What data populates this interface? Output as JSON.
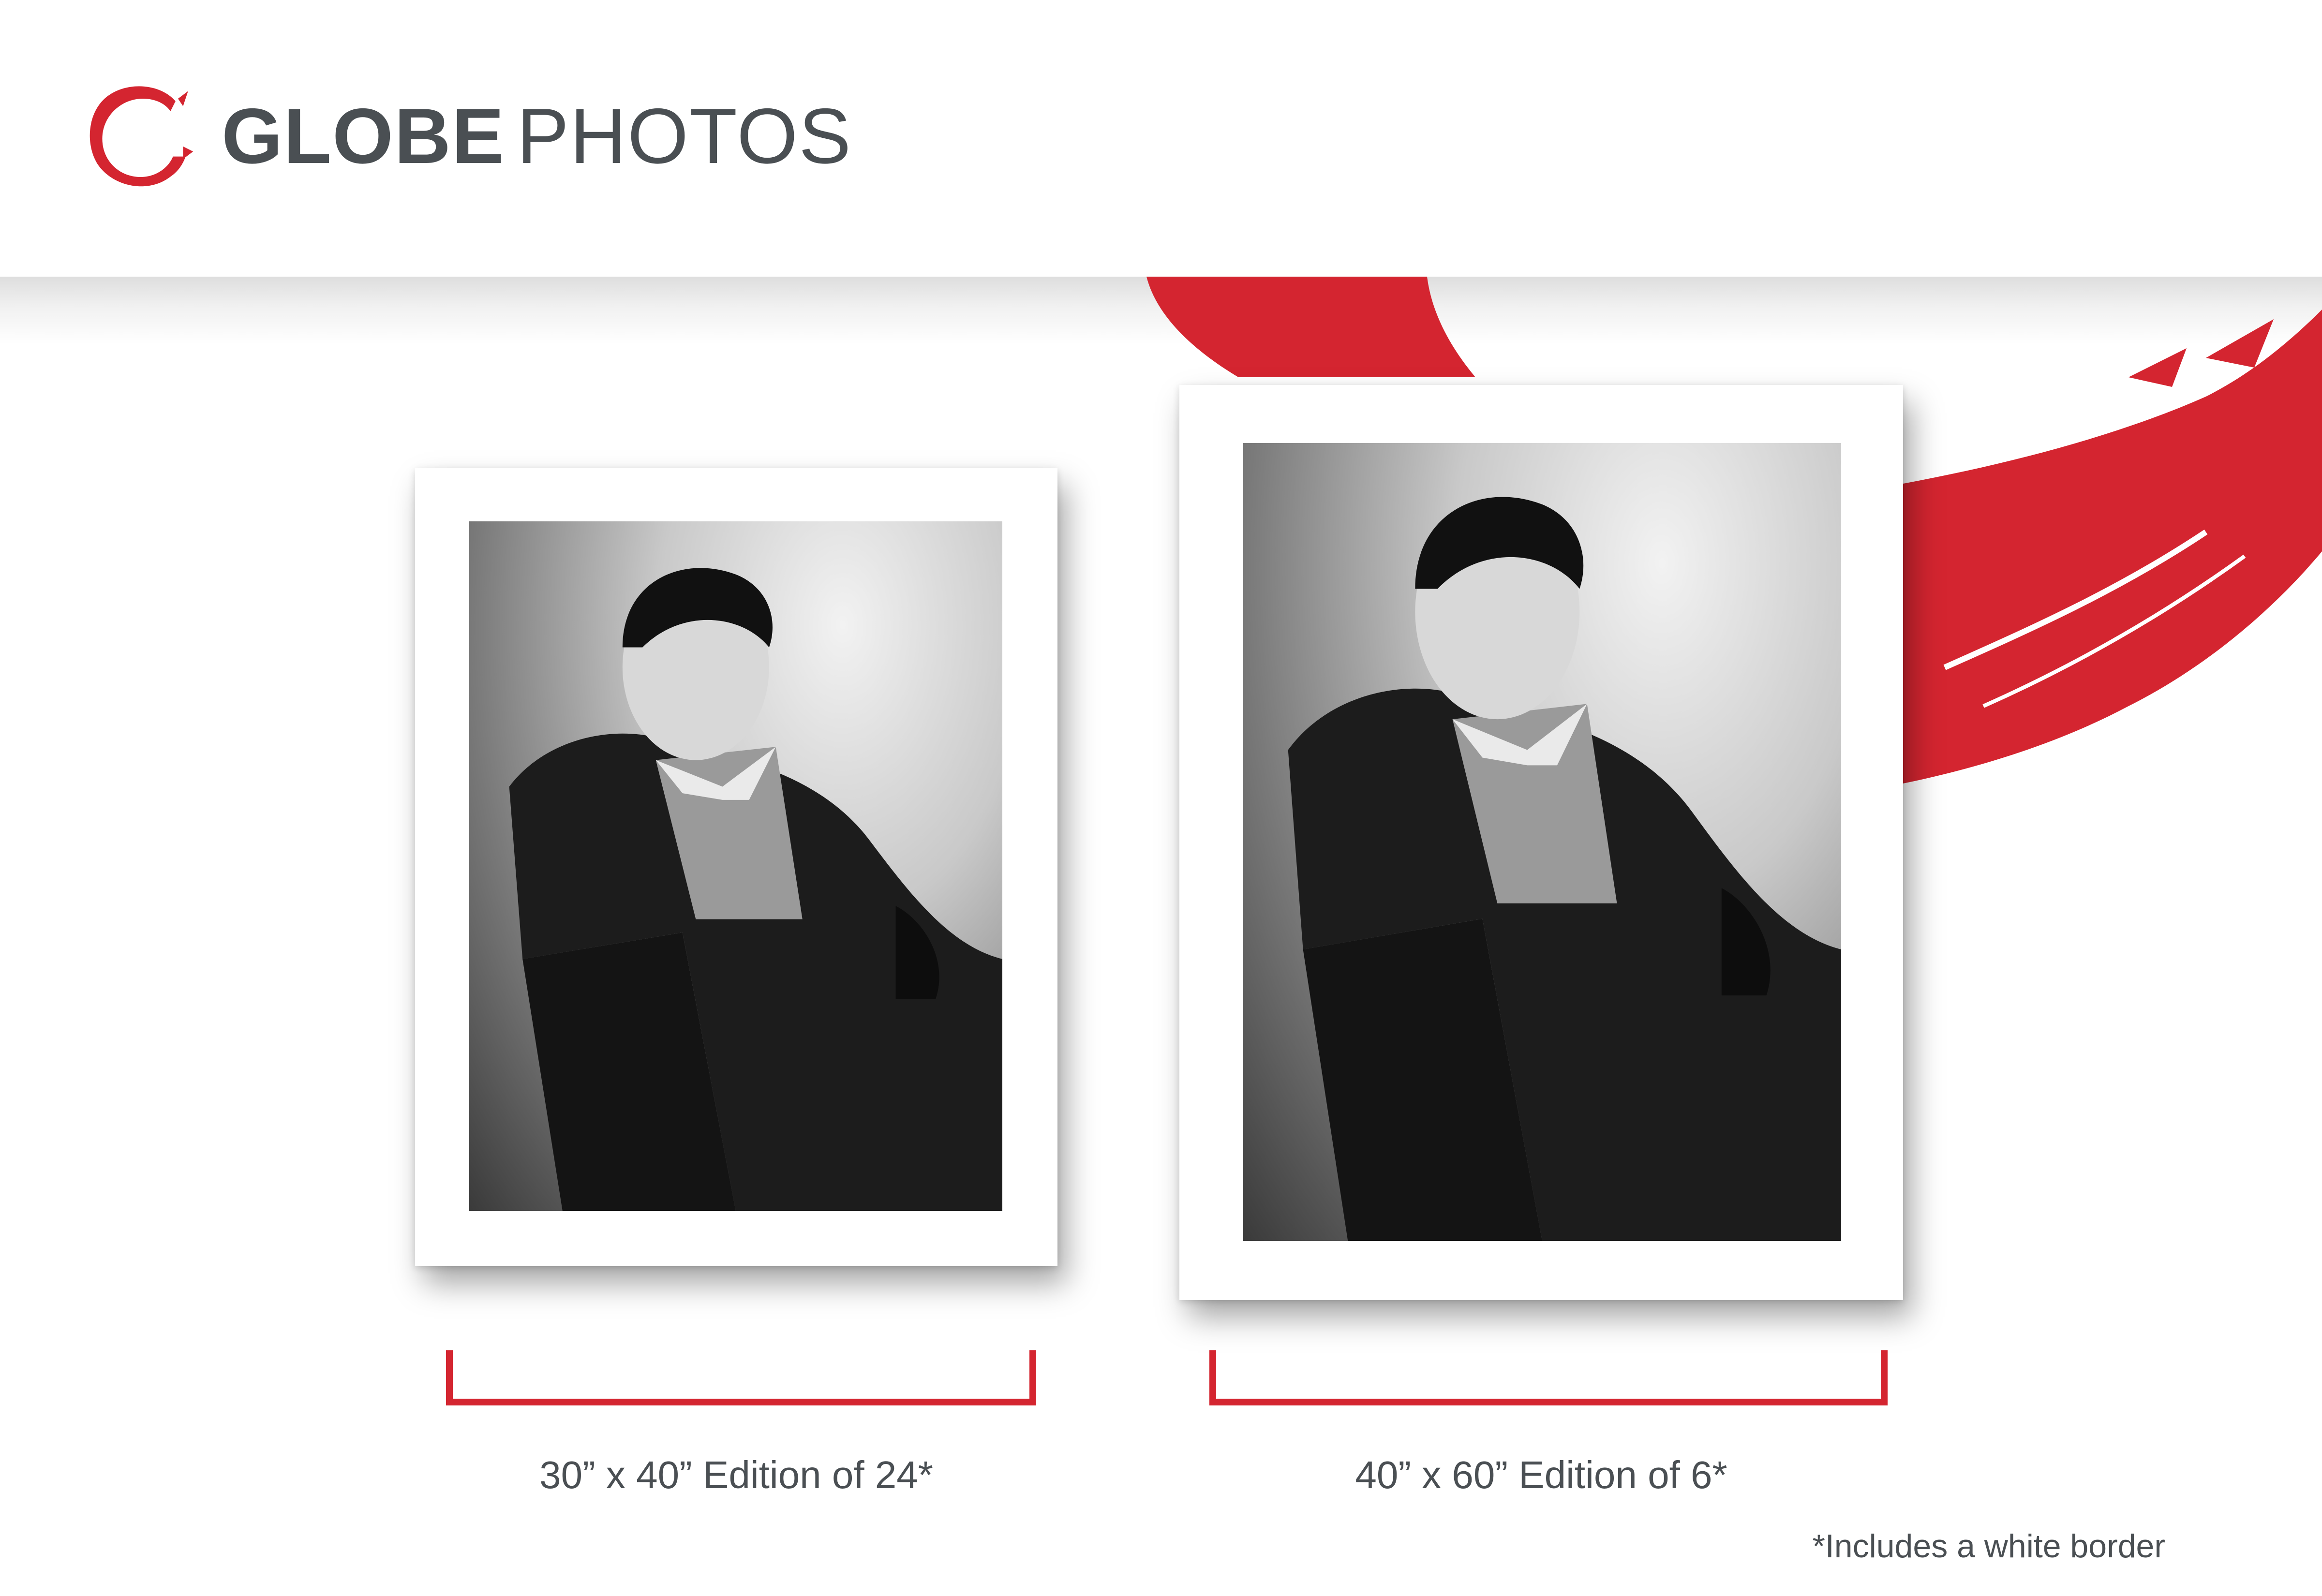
{
  "brand": {
    "name_bold": "GLOBE",
    "name_light": "PHOTOS",
    "logo_icon": "red-brush-circle-icon",
    "accent_color": "#d42530",
    "text_color": "#4a4f53"
  },
  "prints": [
    {
      "size_label": "30” x 40” Edition of 24*"
    },
    {
      "size_label": "40” x 60” Edition of 6*"
    }
  ],
  "footnote": "*Includes a white border"
}
